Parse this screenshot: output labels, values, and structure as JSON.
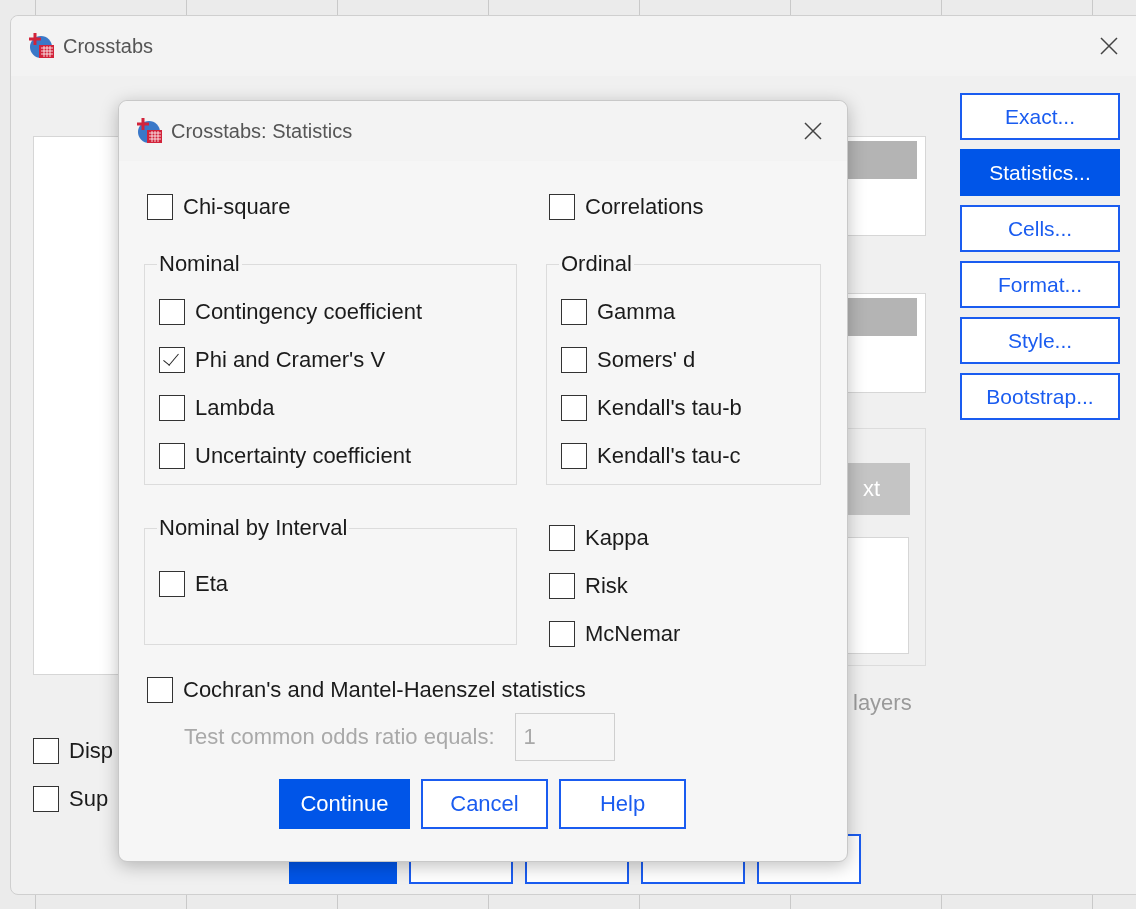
{
  "background_window": {
    "title": "Crosstabs",
    "side_buttons": [
      {
        "label": "Exact...",
        "selected": false
      },
      {
        "label": "Statistics...",
        "selected": true
      },
      {
        "label": "Cells...",
        "selected": false
      },
      {
        "label": "Format...",
        "selected": false
      },
      {
        "label": "Style...",
        "selected": false
      },
      {
        "label": "Bootstrap...",
        "selected": false
      }
    ],
    "next_button": "xt",
    "layers_label": "layers",
    "options": [
      {
        "label": "Disp",
        "checked": false
      },
      {
        "label": "Sup",
        "checked": false
      }
    ],
    "bottom_buttons": [
      {
        "kind": "primary"
      },
      {
        "kind": "normal"
      },
      {
        "kind": "normal"
      },
      {
        "kind": "normal"
      },
      {
        "kind": "normal"
      }
    ]
  },
  "dialog": {
    "title": "Crosstabs: Statistics",
    "chi_square": {
      "label": "Chi-square",
      "checked": false
    },
    "correlations": {
      "label": "Correlations",
      "checked": false
    },
    "nominal": {
      "title": "Nominal",
      "items": [
        {
          "label": "Contingency coefficient",
          "checked": false
        },
        {
          "label": "Phi and Cramer's V",
          "checked": true
        },
        {
          "label": "Lambda",
          "checked": false
        },
        {
          "label": "Uncertainty coefficient",
          "checked": false
        }
      ]
    },
    "ordinal": {
      "title": "Ordinal",
      "items": [
        {
          "label": "Gamma",
          "checked": false
        },
        {
          "label": "Somers' d",
          "checked": false
        },
        {
          "label": "Kendall's tau-b",
          "checked": false
        },
        {
          "label": "Kendall's tau-c",
          "checked": false
        }
      ]
    },
    "nominal_by_interval": {
      "title": "Nominal by Interval",
      "items": [
        {
          "label": "Eta",
          "checked": false
        }
      ]
    },
    "other": [
      {
        "label": "Kappa",
        "checked": false
      },
      {
        "label": "Risk",
        "checked": false
      },
      {
        "label": "McNemar",
        "checked": false
      }
    ],
    "cochran": {
      "label": "Cochran's and Mantel-Haenszel statistics",
      "checked": false
    },
    "odds_ratio": {
      "label": "Test common odds ratio equals:",
      "value": "1",
      "disabled": true
    },
    "buttons": [
      {
        "label": "Continue",
        "kind": "primary"
      },
      {
        "label": "Cancel",
        "kind": "normal"
      },
      {
        "label": "Help",
        "kind": "normal"
      }
    ]
  }
}
